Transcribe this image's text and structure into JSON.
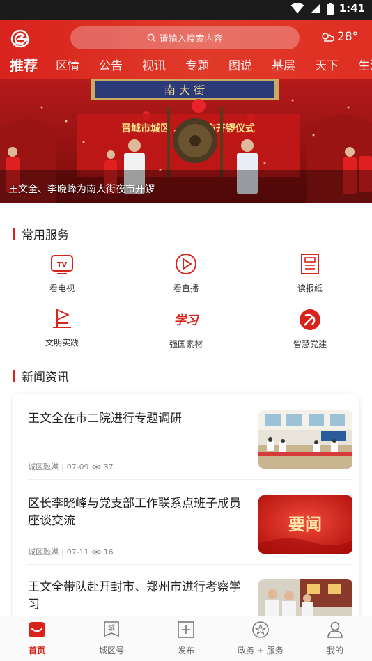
{
  "status_bar": {
    "time": "1:41"
  },
  "header": {
    "search_placeholder": "请输入搜索内容",
    "weather_temp": "28°",
    "tabs": [
      {
        "label": "推荐",
        "active": true
      },
      {
        "label": "区情"
      },
      {
        "label": "公告"
      },
      {
        "label": "视讯"
      },
      {
        "label": "专题"
      },
      {
        "label": "图说"
      },
      {
        "label": "基层"
      },
      {
        "label": "天下"
      },
      {
        "label": "生活"
      }
    ]
  },
  "banner": {
    "caption": "王文全、李晓峰为南大街夜市开锣",
    "sign_text": "晋城市城区 … 市夜市开锣仪式",
    "top_text": "南 大 街"
  },
  "services": {
    "title": "常用服务",
    "items": [
      {
        "label": "看电视",
        "icon": "tv-icon"
      },
      {
        "label": "看直播",
        "icon": "play-icon"
      },
      {
        "label": "读报纸",
        "icon": "newspaper-icon"
      },
      {
        "label": "文明实践",
        "icon": "flag-icon"
      },
      {
        "label": "强国素材",
        "icon": "xuexi-icon",
        "icon_text": "学习"
      },
      {
        "label": "智慧党建",
        "icon": "party-emblem-icon"
      }
    ]
  },
  "news": {
    "title": "新闻资讯",
    "items": [
      {
        "title": "王文全在市二院进行专题调研",
        "source": "城区融媒",
        "date": "07-09",
        "views": "37",
        "thumb": "meeting-photo"
      },
      {
        "title": "区长李晓峰与党支部工作联系点班子成员座谈交流",
        "source": "城区融媒",
        "date": "07-11",
        "views": "16",
        "thumb": "yaowen-graphic",
        "thumb_text": "要闻"
      },
      {
        "title": "王文全带队赴开封市、郑州市进行考察学习",
        "source": "",
        "date": "",
        "views": "",
        "thumb": "group-photo"
      }
    ]
  },
  "bottom_nav": {
    "items": [
      {
        "label": "首页",
        "active": true
      },
      {
        "label": "城区号",
        "icon_text": "城"
      },
      {
        "label": "发布"
      },
      {
        "label": "政务 + 服务"
      },
      {
        "label": "我的"
      }
    ]
  },
  "colors": {
    "brand_red": "#d8231c"
  }
}
